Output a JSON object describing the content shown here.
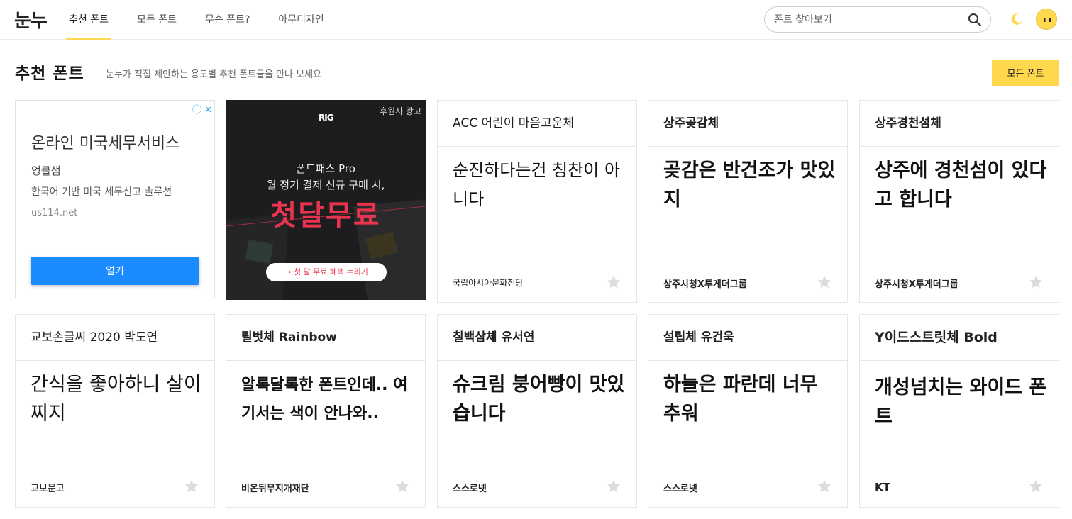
{
  "header": {
    "logo": "눈누",
    "nav": [
      "추천 폰트",
      "모든 폰트",
      "무슨 폰트?",
      "아무디자인"
    ],
    "search_placeholder": "폰트 찾아보기"
  },
  "section": {
    "title": "추천 폰트",
    "description": "눈누가 직접 제안하는 용도별 추천 폰트들을 만나 보세요",
    "all_button": "모든 폰트"
  },
  "ad1": {
    "choices": "ⓘ ✕",
    "title": "온라인 미국세무서비스",
    "brand": "엉클샘",
    "desc": "한국어 기반 미국 세무신고 솔루션",
    "url": "us114.net",
    "open_label": "열기"
  },
  "ad2": {
    "sponsor": "후원사 광고",
    "brand": "RIG",
    "line1": "폰트패스 Pro",
    "line2": "월 정기 결제 신규 구매 시,",
    "big": "첫달무료",
    "cta": "→ 첫 달 무료 혜택 누리기"
  },
  "cards": [
    {
      "name": "ACC 어린이 마음고운체",
      "sample": "순진하다는건 칭찬이 아니다",
      "maker": "국립아시아문화전당"
    },
    {
      "name": "상주곶감체",
      "sample": "곶감은 반건조가 맛있지",
      "maker": "상주시청X투게더그룹"
    },
    {
      "name": "상주경천섬체",
      "sample": "상주에 경천섬이 있다고 합니다",
      "maker": "상주시청X투게더그룹"
    },
    {
      "name": "교보손글씨 2020 박도연",
      "sample": "간식을 좋아하니 살이 찌지",
      "maker": "교보문고"
    },
    {
      "name": "릴벗체 Rainbow",
      "sample": "알록달록한 폰트인데.. 여기서는 색이 안나와..",
      "maker": "비온뒤무지개재단"
    },
    {
      "name": "칠백삼체 유서연",
      "sample": "슈크림 붕어빵이 맛있습니다",
      "maker": "스스로넷"
    },
    {
      "name": "설립체 유건욱",
      "sample": "하늘은 파란데 너무 추워",
      "maker": "스스로넷"
    },
    {
      "name": "Y이드스트릿체 Bold",
      "sample": "개성넘치는 와이드 폰트",
      "maker": "KT"
    }
  ]
}
